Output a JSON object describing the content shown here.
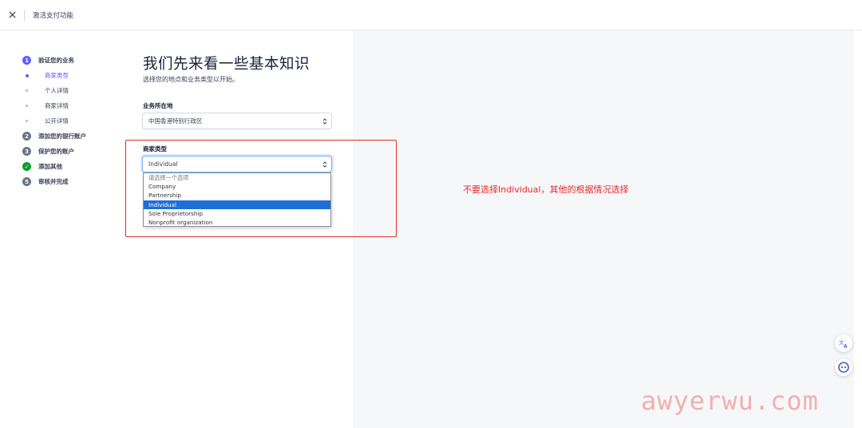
{
  "header": {
    "close_icon": "close-icon",
    "title": "激活支付功能"
  },
  "stepper": {
    "steps": [
      {
        "num": "1",
        "label": "验证您的业务",
        "state": "active"
      },
      {
        "num": "2",
        "label": "添加您的银行账户",
        "state": "pending"
      },
      {
        "num": "3",
        "label": "保护您的账户",
        "state": "pending"
      },
      {
        "num": "✓",
        "label": "添加其他",
        "state": "done"
      },
      {
        "num": "5",
        "label": "审核并完成",
        "state": "pending"
      }
    ],
    "substeps": [
      {
        "label": "商家类型",
        "active": true
      },
      {
        "label": "个人详情",
        "active": false
      },
      {
        "label": "商家详情",
        "active": false
      },
      {
        "label": "公开详情",
        "active": false
      }
    ]
  },
  "form": {
    "title": "我们先来看一些基本知识",
    "subtitle": "选择您的地点和业务类型以开始。",
    "location": {
      "label": "业务所在地",
      "value": "中国香港特别行政区"
    },
    "business_type": {
      "label": "商家类型",
      "value": "Individual",
      "options": [
        "请选择一个选项",
        "Company",
        "Partnership",
        "Individual",
        "Sole Proprietorship",
        "Nonprofit organization"
      ],
      "selected_index": 3
    }
  },
  "annotation": {
    "text": "不要选择Individual，其他的根据情况选择",
    "color": "#e52b2b"
  },
  "floating": {
    "translate_icon": "translate-icon",
    "assistant_icon": "chat-assistant-icon"
  },
  "watermark": "awyerwu.com",
  "colors": {
    "accent": "#635bff",
    "done": "#0e9d2e",
    "selected_option": "#1f6fd6"
  }
}
